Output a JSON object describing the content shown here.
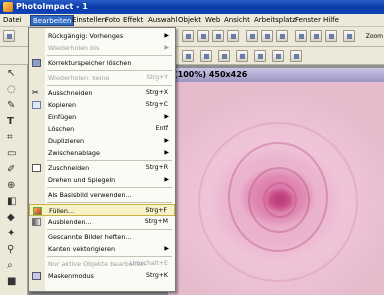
{
  "window": {
    "title": "PhotoImpact - 1"
  },
  "menubar": {
    "items": [
      {
        "label": "Datei"
      },
      {
        "label": "Bearbeiten",
        "active": true
      },
      {
        "label": "Einstellen"
      },
      {
        "label": "Foto"
      },
      {
        "label": "Effekt"
      },
      {
        "label": "Auswahl"
      },
      {
        "label": "Objekt"
      },
      {
        "label": "Web"
      },
      {
        "label": "Ansicht"
      },
      {
        "label": "Arbeitsplatz"
      },
      {
        "label": "Fenster"
      },
      {
        "label": "Hilfe"
      }
    ]
  },
  "toolbar": {
    "zoom_label": "Zoom"
  },
  "document": {
    "title": "(100%) 450x426"
  },
  "edit_menu": {
    "items": [
      {
        "label": "Rückgängig: Vorhenges",
        "shortcut": "",
        "submenu": true,
        "disabled": false,
        "icon": ""
      },
      {
        "label": "Wiederholen bis",
        "shortcut": "",
        "submenu": true,
        "disabled": true,
        "icon": ""
      },
      {
        "label": "Korrekturspeicher löschen",
        "shortcut": "",
        "submenu": false,
        "disabled": false,
        "icon": "eraser-icon"
      },
      {
        "label": "Wiederholen: keine",
        "shortcut": "Strg+Y",
        "submenu": false,
        "disabled": true,
        "icon": ""
      },
      {
        "label": "Ausschneiden",
        "shortcut": "Strg+X",
        "submenu": false,
        "disabled": false,
        "icon": "scissors-icon"
      },
      {
        "label": "Kopieren",
        "shortcut": "Strg+C",
        "submenu": false,
        "disabled": false,
        "icon": "copy-icon"
      },
      {
        "label": "Einfügen",
        "shortcut": "",
        "submenu": true,
        "disabled": false,
        "icon": ""
      },
      {
        "label": "Löschen",
        "shortcut": "Entf",
        "submenu": false,
        "disabled": false,
        "icon": ""
      },
      {
        "label": "Duplizieren",
        "shortcut": "",
        "submenu": true,
        "disabled": false,
        "icon": ""
      },
      {
        "label": "Zwischenablage",
        "shortcut": "",
        "submenu": true,
        "disabled": false,
        "icon": ""
      },
      {
        "label": "Zuschneiden",
        "shortcut": "Strg+R",
        "submenu": false,
        "disabled": false,
        "icon": "crop-icon"
      },
      {
        "label": "Drehen und Spiegeln",
        "shortcut": "",
        "submenu": true,
        "disabled": false,
        "icon": ""
      },
      {
        "label": "Als Basisbild verwenden...",
        "shortcut": "",
        "submenu": false,
        "disabled": false,
        "icon": ""
      },
      {
        "label": "Füllen...",
        "shortcut": "Strg+F",
        "submenu": false,
        "disabled": false,
        "highlighted": true,
        "icon": "fill-icon"
      },
      {
        "label": "Ausblenden...",
        "shortcut": "Strg+M",
        "submenu": false,
        "disabled": false,
        "icon": "fade-icon"
      },
      {
        "label": "Gescannte Bilder heften...",
        "shortcut": "",
        "submenu": false,
        "disabled": false,
        "icon": ""
      },
      {
        "label": "Kanten vektorigieren",
        "shortcut": "",
        "submenu": true,
        "disabled": false,
        "icon": ""
      },
      {
        "label": "Nur aktive Objekte bearbeiten",
        "shortcut": "Umschalt+E",
        "submenu": false,
        "disabled": true,
        "icon": ""
      },
      {
        "label": "Maskenmodus",
        "shortcut": "Strg+K",
        "submenu": false,
        "disabled": false,
        "icon": "mask-icon"
      }
    ]
  }
}
